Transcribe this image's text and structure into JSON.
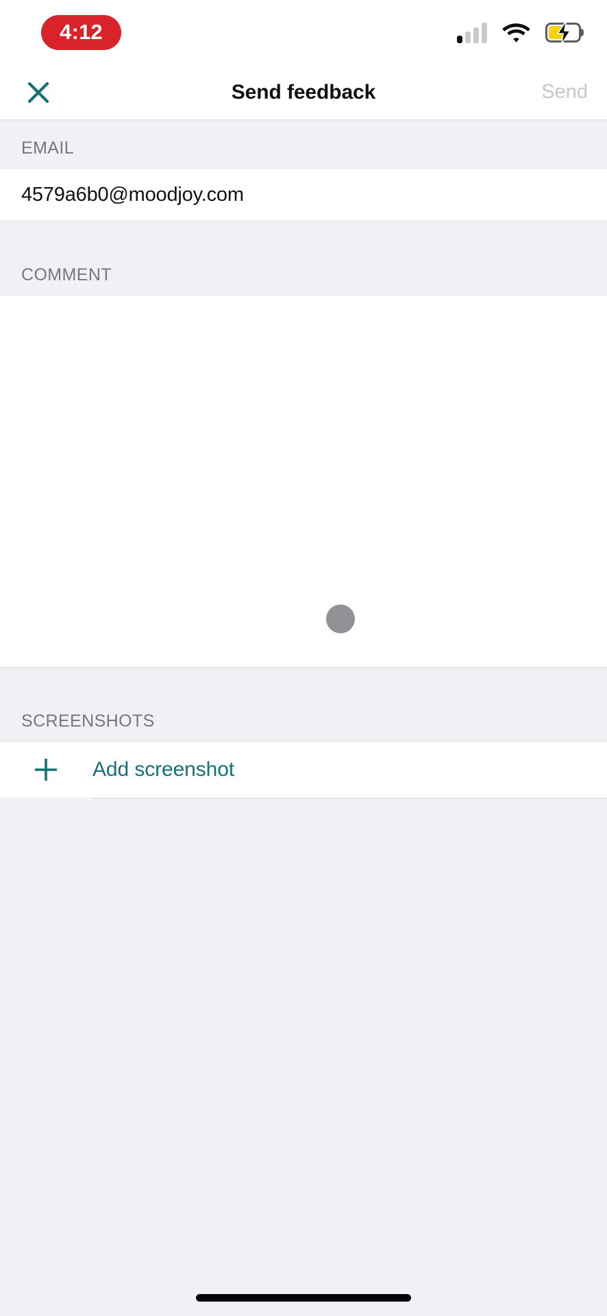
{
  "status_bar": {
    "time": "4:12",
    "time_pill_color": "#d8232a",
    "signal_icon": "cellular-signal-icon",
    "signal_bars_total": 4,
    "signal_bars_active": 1,
    "wifi_icon": "wifi-icon",
    "battery_icon": "battery-charging-icon",
    "battery_fill_color": "#f5d10a"
  },
  "navbar": {
    "close_icon": "close-icon",
    "title": "Send feedback",
    "send_label": "Send",
    "send_enabled": false,
    "accent_color": "#15707a",
    "disabled_color": "#c7c7cc"
  },
  "sections": {
    "email": {
      "header": "EMAIL",
      "value": "4579a6b0@moodjoy.com",
      "placeholder": "Email"
    },
    "comment": {
      "header": "COMMENT",
      "value": "",
      "placeholder": "",
      "loading_indicator": "loading-dot",
      "loading_indicator_color": "#919196"
    },
    "screenshots": {
      "header": "SCREENSHOTS",
      "add_icon": "plus-icon",
      "add_label": "Add screenshot"
    }
  },
  "home_indicator": "home-indicator"
}
